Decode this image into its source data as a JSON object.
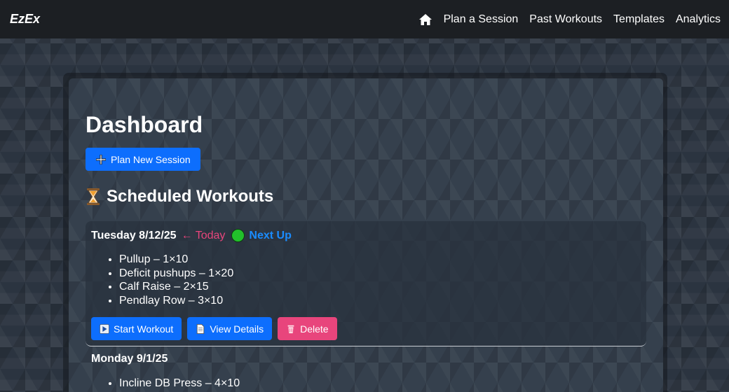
{
  "navbar": {
    "brand": "EzEx",
    "links": [
      "Plan a Session",
      "Past Workouts",
      "Templates",
      "Analytics"
    ]
  },
  "dashboard": {
    "title": "Dashboard",
    "plan_button": "Plan New Session",
    "section_title": "Scheduled Workouts"
  },
  "sessions": [
    {
      "date": "Tuesday 8/12/25",
      "today_label": "← Today",
      "next_up_label": "Next Up",
      "exercises": [
        "Pullup – 1×10",
        "Deficit pushups – 1×20",
        "Calf Raise – 2×15",
        "Pendlay Row – 3×10"
      ],
      "actions": {
        "start": "Start Workout",
        "details": "View Details",
        "delete": "Delete"
      }
    },
    {
      "date": "Monday 9/1/25",
      "exercises": [
        "Incline DB Press – 4×10"
      ]
    }
  ],
  "colors": {
    "primary": "#0d6efd",
    "danger": "#e8457c",
    "today": "#e8457c",
    "next_up": "#1a8cff",
    "status_dot": "#22c02b",
    "navbar": "#1c1f23"
  },
  "icons": [
    "home-icon",
    "plus-icon",
    "hourglass-icon",
    "play-icon",
    "document-icon",
    "trash-icon"
  ]
}
